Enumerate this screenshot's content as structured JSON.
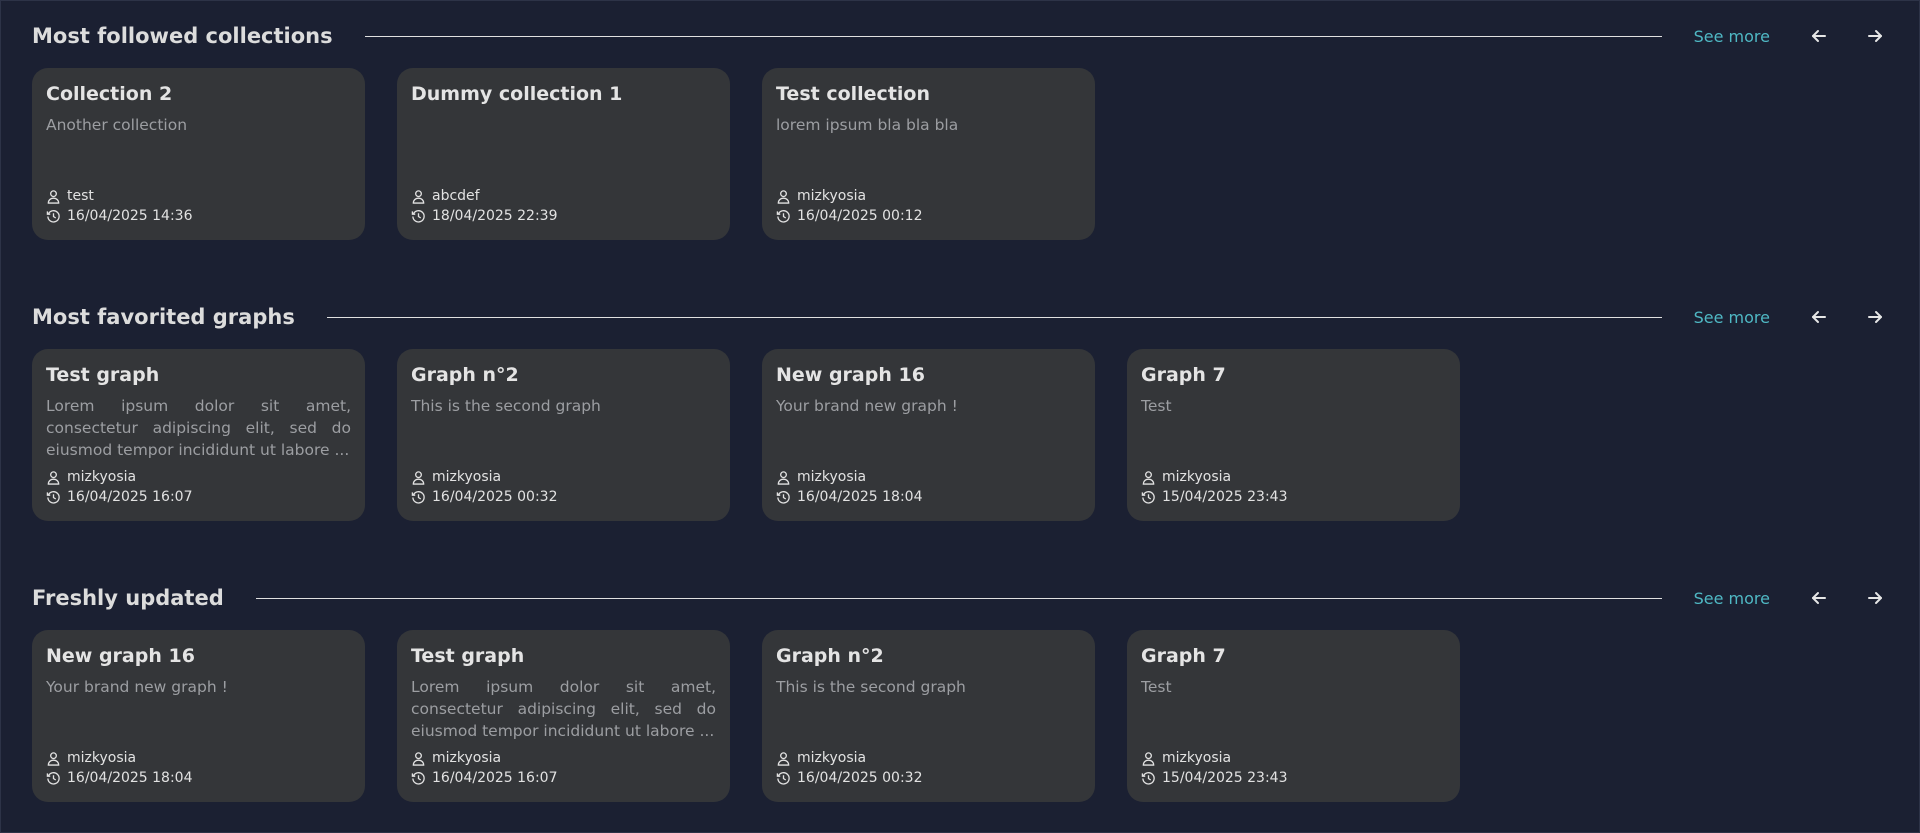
{
  "sections": [
    {
      "title": "Most followed collections",
      "see_more": "See more",
      "cards": [
        {
          "title": "Collection 2",
          "description": "Another collection",
          "author": "test",
          "date": "16/04/2025 14:36"
        },
        {
          "title": "Dummy collection 1",
          "description": "",
          "author": "abcdef",
          "date": "18/04/2025 22:39"
        },
        {
          "title": "Test collection",
          "description": "lorem ipsum bla bla bla",
          "author": "mizkyosia",
          "date": "16/04/2025 00:12"
        }
      ]
    },
    {
      "title": "Most favorited graphs",
      "see_more": "See more",
      "cards": [
        {
          "title": "Test graph",
          "description": "Lorem ipsum dolor sit amet, consectetur adipiscing elit, sed do eiusmod tempor incididunt ut labore ...",
          "author": "mizkyosia",
          "date": "16/04/2025 16:07"
        },
        {
          "title": "Graph n°2",
          "description": "This is the second graph",
          "author": "mizkyosia",
          "date": "16/04/2025 00:32"
        },
        {
          "title": "New graph 16",
          "description": "Your brand new graph !",
          "author": "mizkyosia",
          "date": "16/04/2025 18:04"
        },
        {
          "title": "Graph 7",
          "description": "Test",
          "author": "mizkyosia",
          "date": "15/04/2025 23:43"
        }
      ]
    },
    {
      "title": "Freshly updated",
      "see_more": "See more",
      "cards": [
        {
          "title": "New graph 16",
          "description": "Your brand new graph !",
          "author": "mizkyosia",
          "date": "16/04/2025 18:04"
        },
        {
          "title": "Test graph",
          "description": "Lorem ipsum dolor sit amet, consectetur adipiscing elit, sed do eiusmod tempor incididunt ut labore ...",
          "author": "mizkyosia",
          "date": "16/04/2025 16:07"
        },
        {
          "title": "Graph n°2",
          "description": "This is the second graph",
          "author": "mizkyosia",
          "date": "16/04/2025 00:32"
        },
        {
          "title": "Graph 7",
          "description": "Test",
          "author": "mizkyosia",
          "date": "15/04/2025 23:43"
        }
      ]
    }
  ],
  "icons": {
    "prev": "arrow-left-icon",
    "next": "arrow-right-icon",
    "author": "user-icon",
    "date": "history-icon"
  },
  "colors": {
    "background": "#1b2032",
    "card": "#343639",
    "accent": "#4fb8c4",
    "muted_text": "#9c9ea2"
  }
}
